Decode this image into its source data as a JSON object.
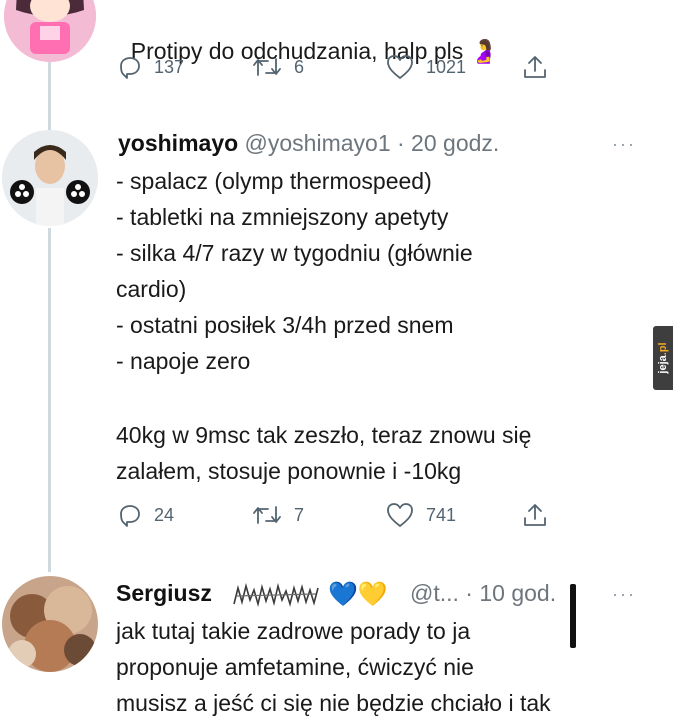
{
  "tweet1": {
    "text": "Protipy do odchudzania, halp pls",
    "emoji": "🤰",
    "replies": "137",
    "retweets": "6",
    "likes": "1021"
  },
  "tweet2": {
    "name": "yoshimayo",
    "handle_time": "@yoshimayo1 · 20 godz.",
    "more": "···",
    "lines": [
      "- spalacz (olymp thermospeed)",
      "- tabletki na zmniejszony apetyty",
      "- silka 4/7 razy w tygodniu (głównie",
      "cardio)",
      "- ostatni posiłek 3/4h przed snem",
      "- napoje zero",
      "",
      "40kg w 9msc tak zeszło, teraz znowu się",
      "zalałem, stosuje ponownie i -10kg"
    ],
    "replies": "24",
    "retweets": "7",
    "likes": "741"
  },
  "tweet3": {
    "name": "Sergiusz",
    "emojis": "💙💛",
    "handle_time": "@t... · 10 god.",
    "more": "···",
    "lines": [
      "jak tutaj takie zadrowe porady to ja",
      "proponuje amfetamine, ćwiczyć nie",
      "musisz a jeść ci się nie będzie chciało i tak"
    ]
  },
  "watermark": {
    "brand": "jeja",
    "tld": ".pl"
  },
  "colors": {
    "thread_line": "#cfd9de",
    "meta": "#536471",
    "heart_blue": "#1d6fd8",
    "heart_yellow": "#f2c12e"
  },
  "icons": [
    "reply-icon",
    "retweet-icon",
    "like-icon",
    "share-icon",
    "more-icon"
  ]
}
